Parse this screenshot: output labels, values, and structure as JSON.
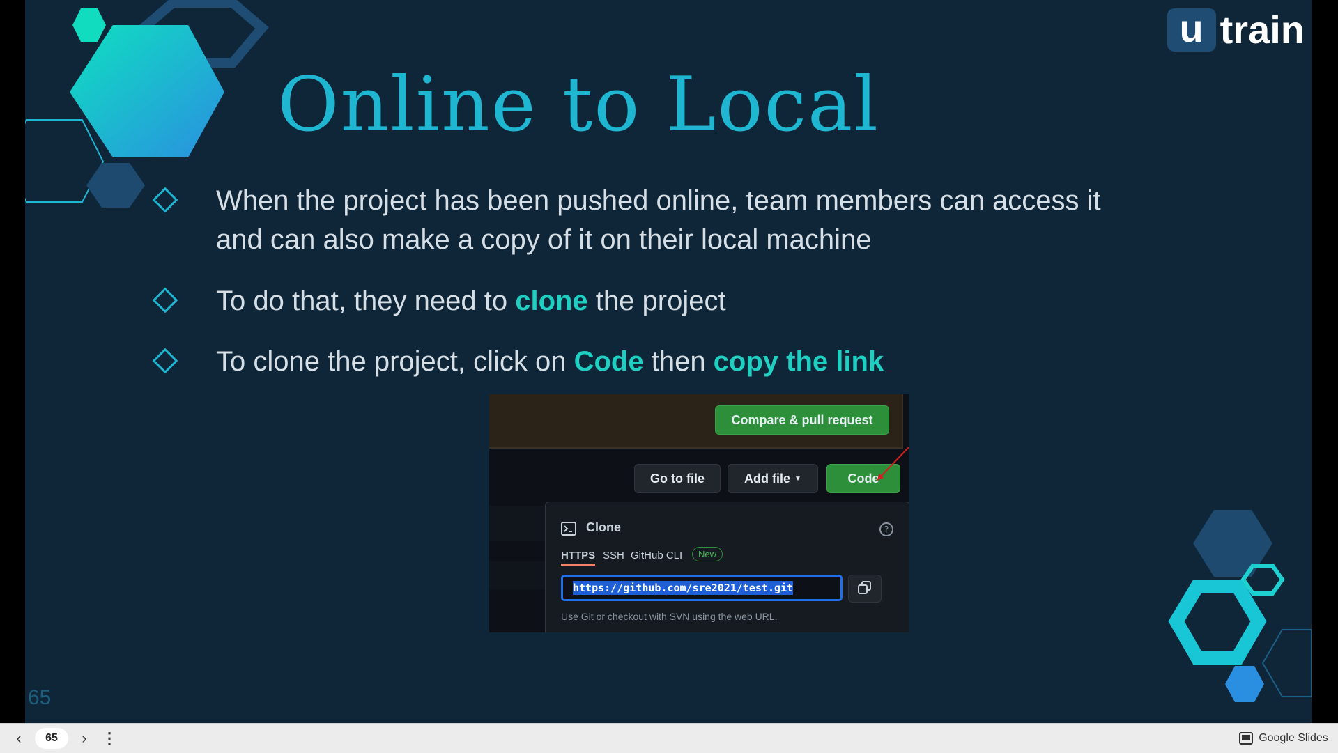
{
  "slide": {
    "title": "Online to Local",
    "bullets": {
      "b1_line1": "When the project has been pushed online, team members can access it",
      "b1_line2": "and can also make a copy of it on their local machine",
      "b2_pre": "To do that, they need to ",
      "b2_hl": "clone",
      "b2_post": " the project",
      "b3_pre": "To clone the project, click on ",
      "b3_hl1": "Code",
      "b3_mid": " then ",
      "b3_hl2": "copy the link"
    },
    "page_number": "65",
    "colors": {
      "background": "#0f2639",
      "accent": "#1fb6d2",
      "highlight": "#1fd0c2"
    }
  },
  "logo": {
    "mark": "u",
    "text": "train"
  },
  "screenshot": {
    "compare_button": "Compare & pull request",
    "go_to_file": "Go to file",
    "add_file": "Add file",
    "code_button": "Code",
    "clone_title": "Clone",
    "tabs": [
      "HTTPS",
      "SSH",
      "GitHub CLI"
    ],
    "new_badge": "New",
    "url": "https://github.com/sre2021/test.git",
    "hint": "Use Git or checkout with SVN using the web URL."
  },
  "bottom_bar": {
    "page_value": "65",
    "app_label": "Google Slides"
  }
}
